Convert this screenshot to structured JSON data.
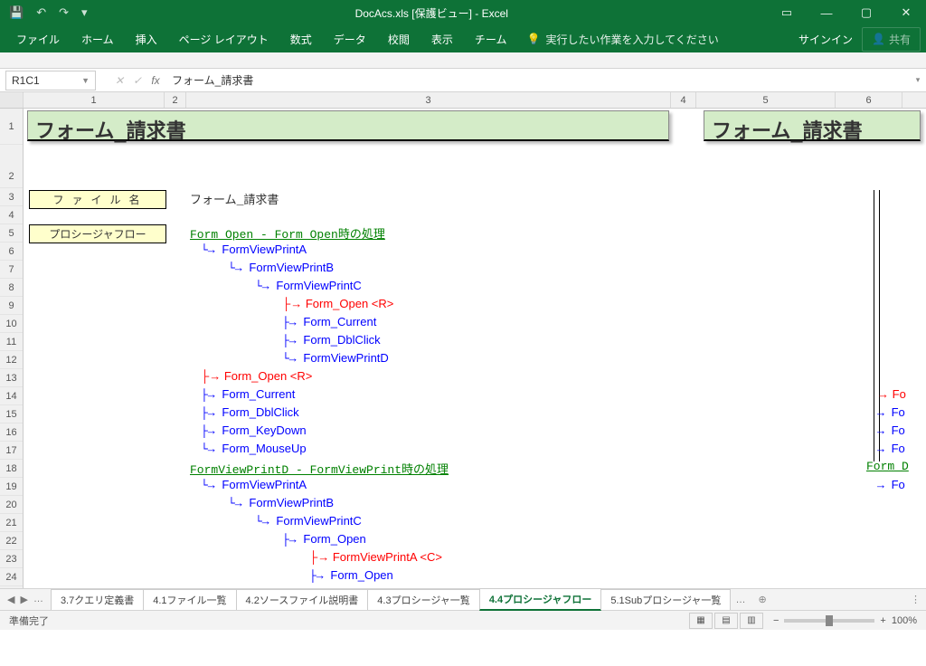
{
  "titlebar": {
    "title": "DocAcs.xls  [保護ビュー] - Excel"
  },
  "qat": {
    "save": "💾",
    "undo": "↶",
    "redo": "↷",
    "custom": "▾"
  },
  "wincontrols": {
    "opts": "▭",
    "min": "—",
    "max": "▢",
    "close": "✕"
  },
  "ribbon": {
    "tabs": [
      "ファイル",
      "ホーム",
      "挿入",
      "ページ レイアウト",
      "数式",
      "データ",
      "校閲",
      "表示",
      "チーム"
    ],
    "tellme_icon": "💡",
    "tellme": "実行したい作業を入力してください",
    "signin": "サインイン",
    "share": "共有"
  },
  "fbar": {
    "name": "R1C1",
    "cancel": "✕",
    "enter": "✓",
    "fx": "fx",
    "formula": "フォーム_請求書"
  },
  "cols": {
    "c1": "1",
    "c2": "2",
    "c3": "3",
    "c4": "4",
    "c5": "5",
    "c6": "6"
  },
  "rows": [
    "1",
    "2",
    "3",
    "4",
    "5",
    "6",
    "7",
    "8",
    "9",
    "10",
    "11",
    "12",
    "13",
    "14",
    "15",
    "16",
    "17",
    "18",
    "19",
    "20",
    "21",
    "22",
    "23",
    "24"
  ],
  "sheet": {
    "header1": "フォーム_請求書",
    "header2": "フォーム_請求書",
    "label_file": "フ ァ イ ル 名",
    "filename": "フォーム_請求書",
    "label_proc": "プロシージャフロー",
    "proc1": "Form_Open - Form_Open時の処理",
    "t": {
      "a1": "FormViewPrintA",
      "a2": "FormViewPrintB",
      "a3": "FormViewPrintC",
      "a4": "Form_Open <R>",
      "a5": "Form_Current",
      "a6": "Form_DblClick",
      "a7": "FormViewPrintD",
      "a8": "Form_Open <R>",
      "a9": "Form_Current",
      "a10": "Form_DblClick",
      "a11": "Form_KeyDown",
      "a12": "Form_MouseUp"
    },
    "proc2": "FormViewPrintD - FormViewPrint時の処理",
    "u": {
      "b1": "FormViewPrintA",
      "b2": "FormViewPrintB",
      "b3": "FormViewPrintC",
      "b4": "Form_Open",
      "b5": "FormViewPrintA <C>",
      "b6": "Form_Open"
    },
    "right": {
      "r1": "Fo",
      "r2": "Fo",
      "r3": "Fo",
      "r4": "Fo",
      "r5": "Form_D",
      "r6": "Fo"
    }
  },
  "tabs": {
    "t1": "3.7クエリ定義書",
    "t2": "4.1ファイル一覧",
    "t3": "4.2ソースファイル説明書",
    "t4": "4.3プロシージャ一覧",
    "t5": "4.4プロシージャフロー",
    "t6": "5.1Subプロシージャ一覧"
  },
  "status": {
    "ready": "準備完了",
    "zoom": "100%"
  }
}
